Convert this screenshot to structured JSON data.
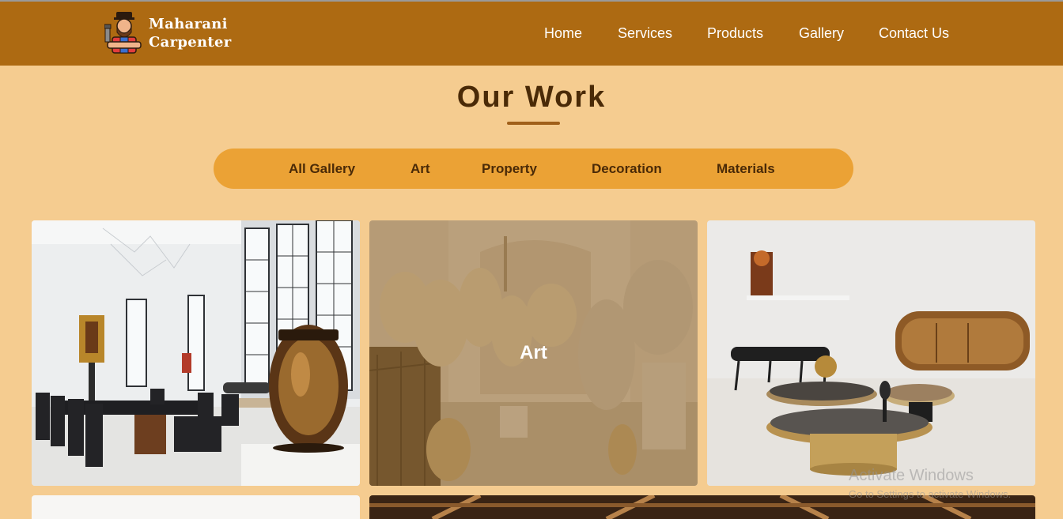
{
  "brand": {
    "line1": "Maharani",
    "line2": "Carpenter",
    "logo_icon": "carpenter-mascot-icon"
  },
  "nav": {
    "items": [
      {
        "label": "Home"
      },
      {
        "label": "Services"
      },
      {
        "label": "Products"
      },
      {
        "label": "Gallery"
      },
      {
        "label": "Contact Us"
      }
    ]
  },
  "section": {
    "title": "Our Work"
  },
  "filters": {
    "items": [
      {
        "label": "All Gallery"
      },
      {
        "label": "Art"
      },
      {
        "label": "Property"
      },
      {
        "label": "Decoration"
      },
      {
        "label": "Materials"
      }
    ]
  },
  "gallery": {
    "hovered_card_label": "Art",
    "cards": [
      {
        "subject": "dining-room-with-carved-vase"
      },
      {
        "subject": "art-gallery-sculptures"
      },
      {
        "subject": "living-room-tables-and-sideboard"
      },
      {
        "subject": "white-interior"
      },
      {
        "subject": "wooden-beam-ceiling"
      }
    ]
  },
  "os_watermark": {
    "title": "Activate Windows",
    "subtitle": "Go to Settings to activate Windows."
  },
  "colors": {
    "navbar": "#ad6a12",
    "page_bg": "#f5cc90",
    "filter_bar": "#eba235",
    "title": "#4a2a07"
  }
}
